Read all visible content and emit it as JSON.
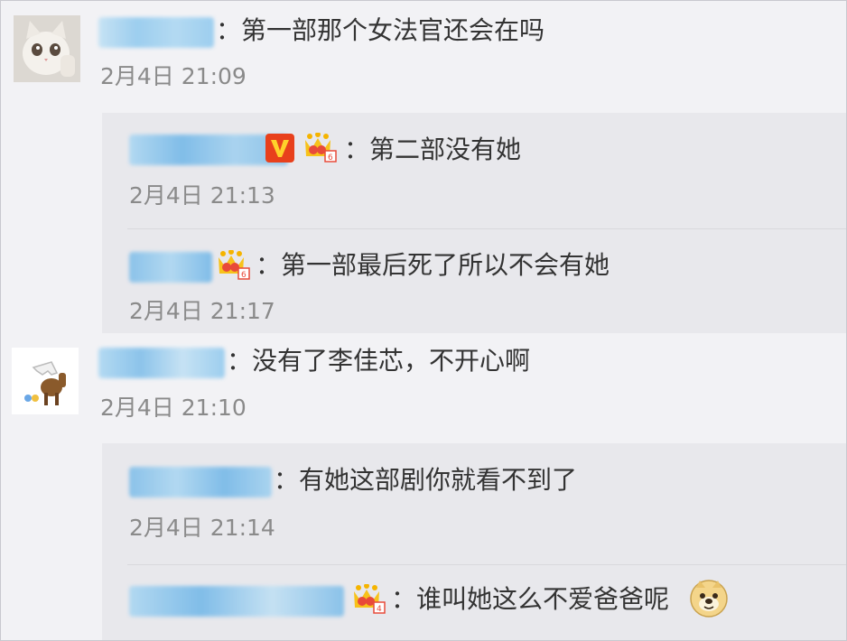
{
  "comments": [
    {
      "text": "：第一部那个女法官还会在吗",
      "time": "2月4日 21:09",
      "avatar": "cat-avatar-icon",
      "replies": [
        {
          "text": "：第二部没有她",
          "time": "2月4日 21:13",
          "badges": [
            "v-verified-icon",
            "crown-icon"
          ]
        },
        {
          "text": "：第一部最后死了所以不会有她",
          "time": "2月4日 21:17",
          "badges": [
            "crown-icon"
          ]
        }
      ]
    },
    {
      "text": "：没有了李佳芯，不开心啊",
      "time": "2月4日 21:10",
      "avatar": "horse-avatar-icon",
      "replies": [
        {
          "text": "：有她这部剧你就看不到了",
          "time": "2月4日 21:14",
          "badges": []
        },
        {
          "text": "：谁叫她这么不爱爸爸呢",
          "time": "",
          "badges": [
            "crown-icon",
            "doge-emoji"
          ]
        }
      ]
    }
  ],
  "colors": {
    "name_blur": "#8ec8ee",
    "text": "#333333",
    "time": "#8a8a8a",
    "reply_bg": "#e8e8ec",
    "page_bg": "#f2f2f5"
  }
}
